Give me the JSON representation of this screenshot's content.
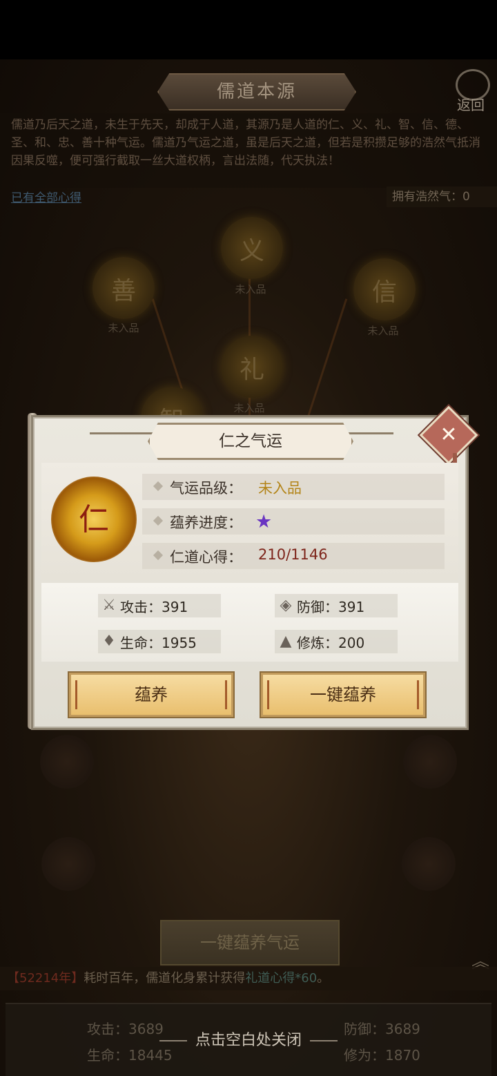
{
  "header": {
    "title": "儒道本源",
    "back_label": "返回",
    "intro": "儒道乃后天之道，未生于先天，却成于人道，其源乃是人道的仁、义、礼、智、信、德、圣、和、忠、善十种气运。儒道乃气运之道，虽是后天之道，但若是积攒足够的浩然气抵消因果反噬，便可强行截取一丝大道权柄，言出法随，代天执法！",
    "all_insights_link": "已有全部心得",
    "owned_label": "拥有浩然气：",
    "owned_value": "0"
  },
  "nodes": [
    {
      "char": "义",
      "status": "未入品"
    },
    {
      "char": "善",
      "status": "未入品"
    },
    {
      "char": "信",
      "status": "未入品"
    },
    {
      "char": "礼",
      "status": "未入品"
    },
    {
      "char": "智",
      "status": ""
    }
  ],
  "bottom": {
    "cultivate_all_label": "一键蕴养气运",
    "log_tag": "【52214年】",
    "log_text": "耗时百年，儒道化身累计获得",
    "log_gain": "礼道心得*60",
    "log_end": "。",
    "close_hint": "点击空白处关闭",
    "stats": {
      "attack": "攻击：3689",
      "defense": "防御：3689",
      "life": "生命：18445",
      "cultivation": "修为：1870"
    }
  },
  "modal": {
    "title": "仁之气运",
    "orb_char": "仁",
    "rows": [
      {
        "label": "气运品级：",
        "value": "未入品"
      },
      {
        "label": "蕴养进度：",
        "value": ""
      },
      {
        "label": "仁道心得：",
        "value": "210/1146"
      }
    ],
    "progress_stars": 1,
    "attrs": {
      "attack": "攻击：391",
      "defense": "防御：391",
      "life": "生命：1955",
      "cultivation": "修炼：200"
    },
    "cultivate_label": "蕴养",
    "cultivate_all_label": "一键蕴养",
    "colors": {
      "grade": "#b38418",
      "insight": "#7d241a",
      "star": "#6a35c2"
    }
  }
}
